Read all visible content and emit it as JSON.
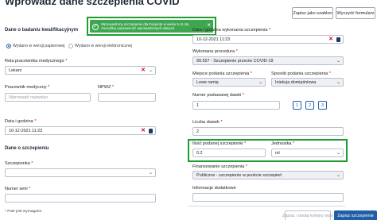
{
  "page": {
    "title": "Wprowadź dane szczepienia COVID"
  },
  "toolbar": {
    "save_template": "Zapisz jako szablon",
    "clear_form": "Wyczyść formularz"
  },
  "toast": {
    "message": "Wprowadzony szczepienie dla Pacjenta w wieku 5-11 lat, zweryfikuj poprawność wprowadzonych danych.",
    "close": "×"
  },
  "left": {
    "qualification_section": "Dane o badaniu kwalifikacyjnym",
    "radio_paper": "Wydano w wersji papierowej",
    "radio_electronic": "Wydano w wersji elektronicznej",
    "role_label": "Rola pracownika medycznego",
    "role_value": "Lekarz",
    "worker_label": "Pracownik medyczny",
    "worker_placeholder": "Wprowadź nazwisko",
    "npwz_label": "NPWZ",
    "date_label": "Data i godzina",
    "date_value": "10-12-2021 11:23",
    "vaccination_section": "Dane o szczepieniu",
    "vaccine_label": "Szczepionka",
    "series_label": "Numer serii",
    "required_note": "* Pole jest wymagane."
  },
  "right": {
    "exec_datetime_label": "Data i godzina wykonania szczepienia",
    "exec_datetime_value": "10-12-2021 11:23",
    "procedure_label": "Wykonana procedura",
    "procedure_value": "99.557 - Szczepienie przeciw COVID-19",
    "place_label": "Miejsce podania szczepienia",
    "place_value": "Lewe ramię",
    "method_label": "Sposób podania szczepienia",
    "method_value": "Iniekcja domięśniowa",
    "dose_number_label": "Numer podawanej dawki",
    "dose_number_value": "1",
    "dose_buttons": [
      "1",
      "2",
      "3"
    ],
    "dose_count_label": "Liczba dawek",
    "dose_count_value": "2",
    "quantity_label": "Ilość podanej szczepionki",
    "quantity_value": "0.2",
    "unit_label": "Jednostka",
    "unit_value": "ml",
    "funding_label": "Finansowanie szczepienia",
    "funding_value": "Publiczne - szczepienie w punkcie szczepień",
    "additional_info_label": "Informacje dodatkowe"
  },
  "footer": {
    "save_draft": "Zapisz i dodaj kolejny wpis",
    "save": "Zapisz szczepienie"
  },
  "colors": {
    "highlight": "#1f9d2f",
    "toast": "#3ea64f",
    "primary": "#1f5fa8",
    "required": "#d0021b"
  },
  "icons": {
    "check": "check-circle-icon",
    "clear": "clear-icon",
    "dropdown": "chevron-down-icon",
    "calendar": "calendar-icon"
  }
}
